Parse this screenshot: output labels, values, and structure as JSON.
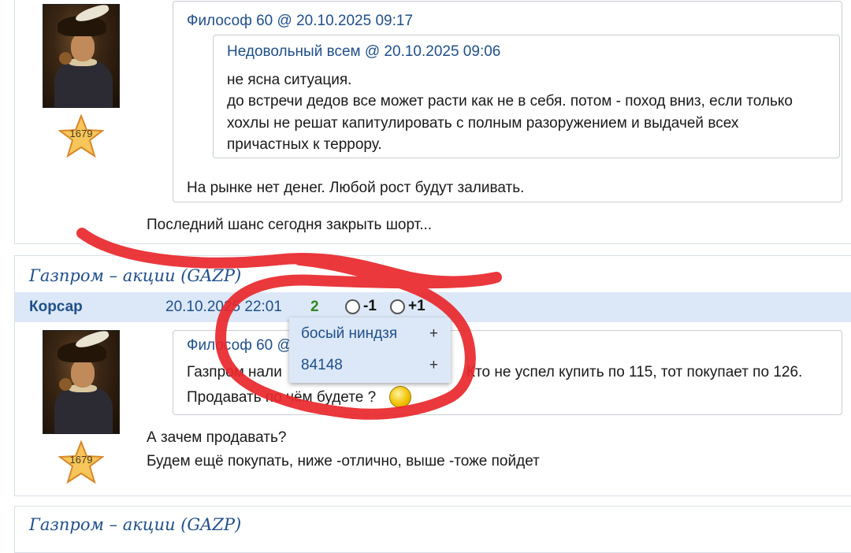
{
  "posts": [
    {
      "avatar": "musketeer-avatar",
      "star_rating": "1679",
      "quote": {
        "author": "Философ 60 @ 20.10.2025 09:17",
        "nested_quote": {
          "author": "Недовольный всем @ 20.10.2025 09:06",
          "lines": [
            "не ясна ситуация.",
            "до встречи дедов все может расти как не в себя. потом - поход вниз, если только",
            "хохлы не решат капитулировать с полным разоружением и выдачей всех",
            "причастных к террору."
          ]
        },
        "text": "На рынке нет денег. Любой рост будут заливать."
      },
      "body": "Последний шанс сегодня закрыть шорт..."
    },
    {
      "topic": "Газпром – акции (GAZP)",
      "author": "Корсар",
      "date": "20.10.2025 22:01",
      "rating": "2",
      "vote_down": "-1",
      "vote_up": "+1",
      "avatar": "musketeer-avatar",
      "star_rating": "1679",
      "quote": {
        "author": "Философ 60 @",
        "line1_left": "Газпром нали",
        "line1_right": "Кто не успел купить по 115, тот покупает по 126.",
        "line2": "Продавать по чём будете ?",
        "emoji": "thinking-smiley-icon"
      },
      "body": [
        "А зачем продавать?",
        "Будем ещё покупать, ниже -отлично, выше -тоже пойдет"
      ],
      "voters_dropdown": [
        {
          "name": "босый ниндзя",
          "action": "+"
        },
        {
          "name": "84148",
          "action": "+"
        }
      ]
    },
    {
      "topic": "Газпром – акции (GAZP)"
    }
  ],
  "colors": {
    "link": "#1f4f8a",
    "author_bar": "#dce8f7",
    "rating_positive": "#2d8a1f",
    "scribble": "#e8272b"
  }
}
